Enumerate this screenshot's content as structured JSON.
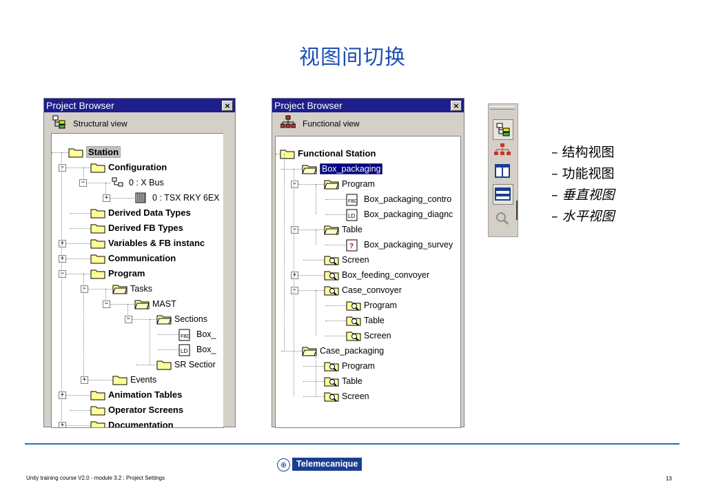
{
  "slide": {
    "title": "视图间切换"
  },
  "left_browser": {
    "title": "Project Browser",
    "close": "×",
    "view_label": "Structural view",
    "rows": [
      {
        "label": "Station"
      },
      {
        "label": "Configuration"
      },
      {
        "label": "0 : X Bus"
      },
      {
        "label": "0 : TSX RKY 6EX"
      },
      {
        "label": "Derived Data Types"
      },
      {
        "label": "Derived FB Types"
      },
      {
        "label": "Variables & FB instanc"
      },
      {
        "label": "Communication"
      },
      {
        "label": "Program"
      },
      {
        "label": "Tasks"
      },
      {
        "label": "MAST"
      },
      {
        "label": "Sections"
      },
      {
        "label": "Box_"
      },
      {
        "label": "Box_"
      },
      {
        "label": "SR Sectior"
      },
      {
        "label": "Events"
      },
      {
        "label": "Animation Tables"
      },
      {
        "label": "Operator Screens"
      },
      {
        "label": "Documentation"
      }
    ]
  },
  "right_browser": {
    "title": "Project Browser",
    "close": "×",
    "view_label": "Functional view",
    "rows": [
      {
        "label": "Functional  Station"
      },
      {
        "label": "Box_packaging"
      },
      {
        "label": "Program"
      },
      {
        "label": "Box_packaging_contro"
      },
      {
        "label": "Box_packaging_diagnc"
      },
      {
        "label": "Table"
      },
      {
        "label": "Box_packaging_survey"
      },
      {
        "label": "Screen"
      },
      {
        "label": "Box_feeding_convoyer"
      },
      {
        "label": "Case_convoyer"
      },
      {
        "label": "Program"
      },
      {
        "label": "Table"
      },
      {
        "label": "Screen"
      },
      {
        "label": "Case_packaging"
      },
      {
        "label": "Program"
      },
      {
        "label": "Table"
      },
      {
        "label": "Screen"
      }
    ]
  },
  "toolbar": {
    "buttons": [
      {
        "icon": "structural-view-icon"
      },
      {
        "icon": "functional-view-icon"
      },
      {
        "icon": "vertical-split-icon"
      },
      {
        "icon": "horizontal-split-icon"
      },
      {
        "icon": "zoom-icon"
      }
    ]
  },
  "bullets": [
    {
      "text": "– 结构视图"
    },
    {
      "text": "– 功能视图"
    },
    {
      "text": "– 垂直视图"
    },
    {
      "text": "– 水平视图"
    }
  ],
  "footer": {
    "left": "Unity training course V2.0 - module 3.2  : Project Settings",
    "page": "13",
    "logo_text": "Telemecanique"
  },
  "colors": {
    "title": "#1a4fb5",
    "window_title_bar": "#1e1e8c",
    "selection": "#000080",
    "footer_line": "#2e6eb5",
    "logo": "#1a3d8f"
  }
}
